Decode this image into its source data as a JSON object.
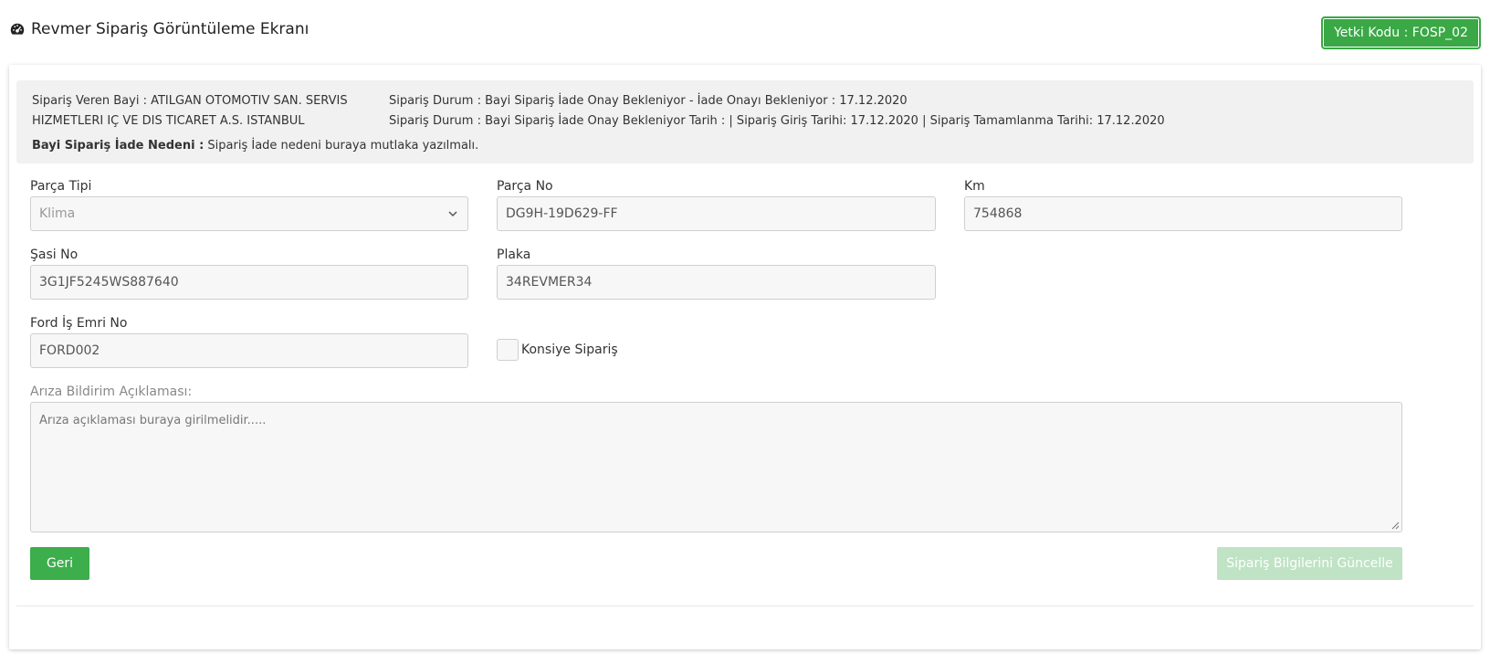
{
  "header": {
    "title": "Revmer Sipariş Görüntüleme Ekranı",
    "title_icon": "dashboard-icon",
    "auth_badge": "Yetki Kodu : FOSP_02",
    "badge_color": "#39a845"
  },
  "info": {
    "dealer": "Sipariş Veren Bayi : ATILGAN OTOMOTIV SAN. SERVIS HIZMETLERI IÇ VE DIS TICARET A.S. ISTANBUL",
    "status_line1": "Sipariş Durum : Bayi Sipariş İade Onay Bekleniyor - İade Onayı Bekleniyor : 17.12.2020",
    "status_line2": "Sipariş Durum : Bayi Sipariş İade Onay Bekleniyor Tarih : | Sipariş Giriş Tarihi: 17.12.2020 | Sipariş Tamamlanma Tarihi: 17.12.2020",
    "reason_label": "Bayi Sipariş İade Nedeni :",
    "reason_text": "Sipariş İade nedeni buraya mutlaka yazılmalı."
  },
  "form": {
    "part_type": {
      "label": "Parça Tipi",
      "value": "Klima",
      "icon": "chevron-down-icon"
    },
    "part_no": {
      "label": "Parça No",
      "value": "DG9H-19D629-FF"
    },
    "km": {
      "label": "Km",
      "value": "754868"
    },
    "chassis_no": {
      "label": "Şasi No",
      "value": "3G1JF5245WS887640"
    },
    "plate": {
      "label": "Plaka",
      "value": "34REVMER34"
    },
    "ford_work_order": {
      "label": "Ford İş Emri No",
      "value": "FORD002"
    },
    "consignment": {
      "label": "Konsiye Sipariş",
      "checked": false
    },
    "fault_description": {
      "label": "Arıza Bildirim Açıklaması:",
      "value": "Arıza açıklaması buraya girilmelidir....."
    }
  },
  "actions": {
    "back_label": "Geri",
    "update_label": "Sipariş Bilgilerini Güncelle",
    "back_color": "#3cae4c",
    "update_color": "#bfe3c4"
  }
}
